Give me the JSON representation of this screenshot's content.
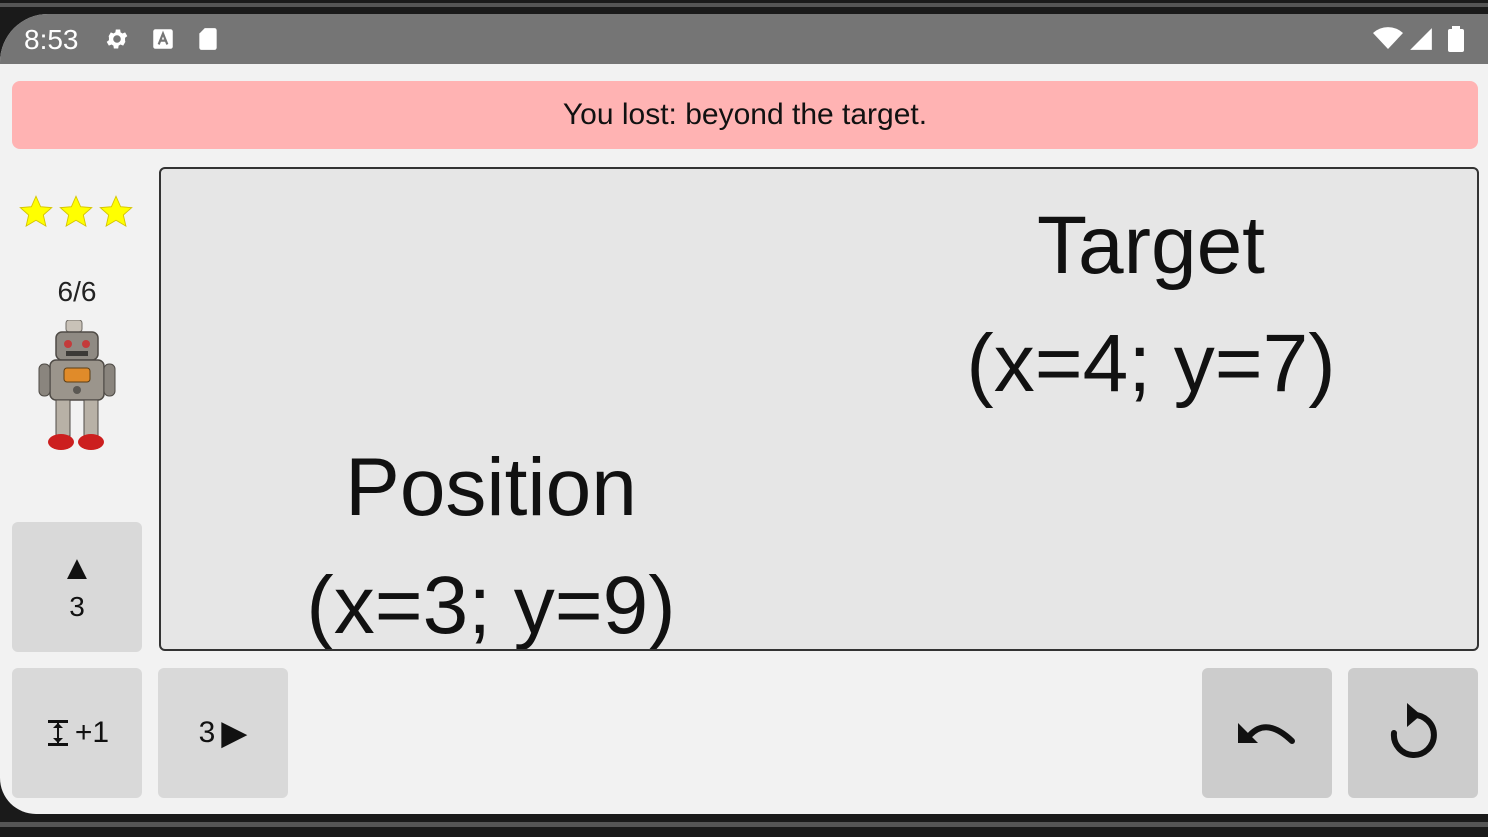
{
  "status_bar": {
    "time": "8:53",
    "icons": [
      "gear-icon",
      "a-box-icon",
      "sd-card-icon",
      "wifi-icon",
      "signal-icon",
      "battery-icon"
    ]
  },
  "banner": {
    "message": "You lost: beyond the target.",
    "color": "#ffb3b3"
  },
  "sidebar": {
    "stars": 3,
    "progress": "6/6",
    "robot_icon": "robot-icon"
  },
  "board": {
    "target_title": "Target",
    "target_coords": "(x=4; y=7)",
    "position_title": "Position",
    "position_coords": "(x=3; y=9)"
  },
  "controls": {
    "up_symbol": "▲",
    "up_value": "3",
    "extend_label": "+1",
    "right_value": "3",
    "right_symbol": "▶",
    "undo_icon": "undo-icon",
    "restart_icon": "restart-icon"
  }
}
